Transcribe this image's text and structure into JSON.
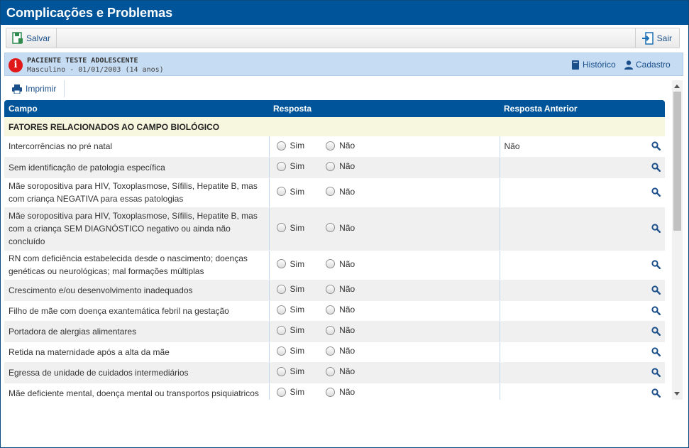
{
  "window": {
    "title": "Complicações e Problemas"
  },
  "toolbar": {
    "save_label": "Salvar",
    "exit_label": "Sair"
  },
  "patient": {
    "name": "PACIENTE TESTE ADOLESCENTE",
    "details": "Masculino - 01/01/2003 (14 anos)",
    "history_label": "Histórico",
    "register_label": "Cadastro"
  },
  "print": {
    "label": "Imprimir"
  },
  "table": {
    "headers": {
      "field": "Campo",
      "answer": "Resposta",
      "previous": "Resposta Anterior"
    },
    "section_title": "FATORES RELACIONADOS AO CAMPO BIOLÓGICO",
    "option_yes": "Sim",
    "option_no": "Não",
    "rows": [
      {
        "field": "Intercorrências no pré natal",
        "previous": "Não"
      },
      {
        "field": "Sem identificação de patologia específica",
        "previous": ""
      },
      {
        "field": "Mãe soropositiva para HIV, Toxoplasmose, Sífilis, Hepatite B, mas com criança NEGATIVA para essas patologias",
        "previous": ""
      },
      {
        "field": "Mãe soropositiva para HIV, Toxoplasmose, Sífilis, Hepatite B, mas com a criança SEM DIAGNÓSTICO negativo ou ainda não concluído",
        "previous": ""
      },
      {
        "field": "RN com deficiência estabelecida desde o nascimento; doenças genéticas ou neurológicas; mal formações múltiplas",
        "previous": ""
      },
      {
        "field": "Crescimento e/ou desenvolvimento inadequados",
        "previous": ""
      },
      {
        "field": "Filho de mãe com doença exantemática febril na gestação",
        "previous": ""
      },
      {
        "field": "Portadora de alergias alimentares",
        "previous": ""
      },
      {
        "field": "Retida na maternidade após a alta da mãe",
        "previous": ""
      },
      {
        "field": "Egressa de unidade de cuidados intermediários",
        "previous": ""
      },
      {
        "field": "Mãe deficiente mental, doença mental ou transportos psiquiatricos",
        "previous": ""
      }
    ]
  },
  "colors": {
    "primary": "#00559a",
    "patient_bar": "#c6dcf3",
    "section_bg": "#f7f7df",
    "alert": "#e01818"
  }
}
